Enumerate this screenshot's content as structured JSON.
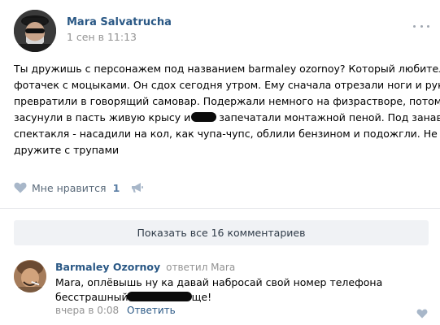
{
  "post": {
    "author": "Mara Salvatrucha",
    "date": "1 сен в 11:13",
    "text_lines": [
      "Ты дружишь с персонажем под названием barmaley ozornoy? Который любитель",
      "фотачек с моцыками. Он сдох сегодня утром. Ему сначала отрезали ноги и руки,",
      "превратили в говорящий самовар. Подержали немного на физрастворе, потом",
      [
        "засунули в пасть живую крысу и",
        "запечатали монтажной пеной. Под занавес"
      ],
      "спектакля - насадили на кол, как чупа-чупс, облили бензином и подожгли. Не",
      "дружите с трупами"
    ],
    "likes": {
      "label": "Мне нравится",
      "count": "1"
    },
    "icons": {
      "menu": "more-dots-icon",
      "like": "heart-icon",
      "share": "megaphone-icon"
    }
  },
  "comments_bar": {
    "show_all_label": "Показать все 16 комментариев"
  },
  "comment": {
    "author": "Barmaley Ozornoy",
    "replied_to": "ответил Mara",
    "text_lines": [
      "Mara, оплёвышь ну ка давай набросай свой номер телефона",
      [
        "бесстрашный",
        "ще!"
      ]
    ],
    "date": "вчера в 0:08",
    "reply_label": "Ответить"
  },
  "colors": {
    "link": "#2a5885",
    "muted": "#939393",
    "icon": "#a0a7b1",
    "button_bg": "#f0f2f5",
    "divider": "#e7e8ec"
  }
}
